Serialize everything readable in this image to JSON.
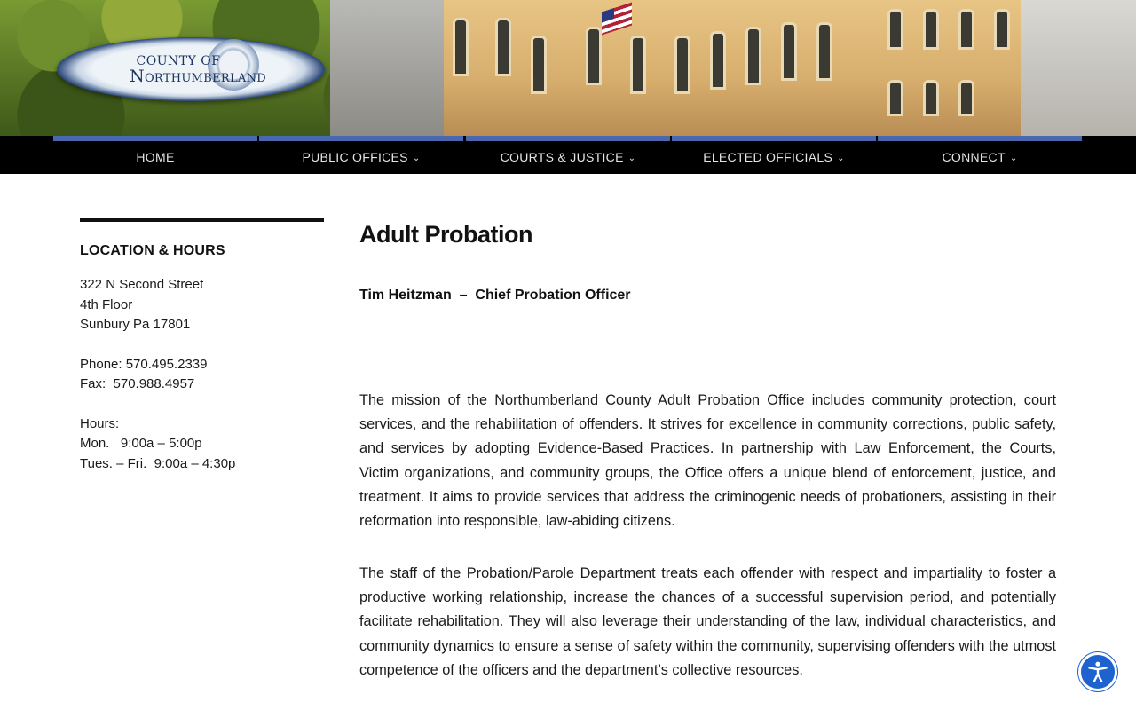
{
  "header": {
    "logo": {
      "line1": "County of",
      "line2": "Northumberland"
    }
  },
  "nav": {
    "items": [
      {
        "label": "HOME",
        "has_dropdown": false
      },
      {
        "label": "PUBLIC OFFICES",
        "has_dropdown": true
      },
      {
        "label": "COURTS & JUSTICE",
        "has_dropdown": true
      },
      {
        "label": "ELECTED OFFICIALS",
        "has_dropdown": true
      },
      {
        "label": "CONNECT",
        "has_dropdown": true
      }
    ],
    "accent_color": "#4a68b0",
    "chevron_icon": "chevron-down-icon"
  },
  "sidebar": {
    "heading": "LOCATION & HOURS",
    "address": [
      "322 N Second Street",
      "4th Floor",
      "Sunbury Pa 17801"
    ],
    "phone": "Phone: 570.495.2339",
    "fax": "Fax:  570.988.4957",
    "hours_label": "Hours:",
    "hours": [
      "Mon.   9:00a – 5:00p",
      "Tues. – Fri.  9:00a – 4:30p"
    ]
  },
  "main": {
    "title": "Adult Probation",
    "officer": "Tim Heitzman  –  Chief Probation Officer",
    "paragraphs": [
      "The mission of the Northumberland County Adult Probation Office includes community protection, court services, and the rehabilitation of offenders. It strives for excellence in community corrections, public safety, and services by adopting Evidence-Based Practices. In partnership with Law Enforcement, the Courts, Victim organizations, and community groups, the Office offers a unique blend of enforcement, justice, and treatment. It aims to provide services that address the criminogenic needs of probationers, assisting in their reformation into responsible, law-abiding citizens.",
      "The staff of the Probation/Parole Department treats each offender with respect and impartiality to foster a productive working relationship, increase the chances of a successful supervision period, and potentially facilitate rehabilitation.  They will also leverage their understanding of the law, individual characteristics, and community dynamics to ensure a sense of safety within the community, supervising offenders with the utmost competence of the officers and the department’s collective resources."
    ]
  },
  "accessibility": {
    "icon": "accessibility-person-icon",
    "color": "#1e62d0"
  }
}
